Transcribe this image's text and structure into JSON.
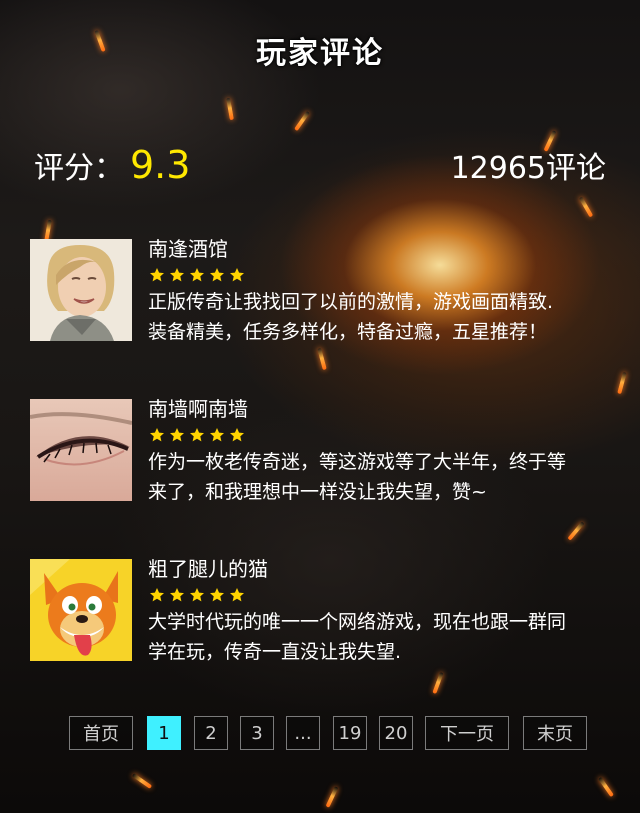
{
  "header": {
    "title": "玩家评论"
  },
  "summary": {
    "score_label": "评分：",
    "score_value": "9.3",
    "review_count": "12965评论"
  },
  "reviews": [
    {
      "name": "南逢酒馆",
      "rating": 5,
      "comment_line1": "正版传奇让我找回了以前的激情，游戏画面精致.",
      "comment_line2": "装备精美，任务多样化，特备过瘾，五星推荐！",
      "avatar": "woman-portrait-avatar"
    },
    {
      "name": "南墙啊南墙",
      "rating": 5,
      "comment_line1": "作为一枚老传奇迷，等这游戏等了大半年，终于等",
      "comment_line2": "来了，和我理想中一样没让我失望，赞~",
      "avatar": "eye-closeup-avatar"
    },
    {
      "name": "粗了腿儿的猫",
      "rating": 5,
      "comment_line1": "大学时代玩的唯一一个网络游戏，现在也跟一群同",
      "comment_line2": "学在玩，传奇一直没让我失望.",
      "avatar": "cartoon-fox-avatar"
    }
  ],
  "pagination": {
    "first": "首页",
    "p1": "1",
    "p2": "2",
    "p3": "3",
    "ellipsis": "...",
    "p19": "19",
    "p20": "20",
    "next": "下一页",
    "last": "末页",
    "current": "1"
  },
  "colors": {
    "score": "#ffe800",
    "star": "#ffd400",
    "active_page": "#3ff0ff"
  }
}
